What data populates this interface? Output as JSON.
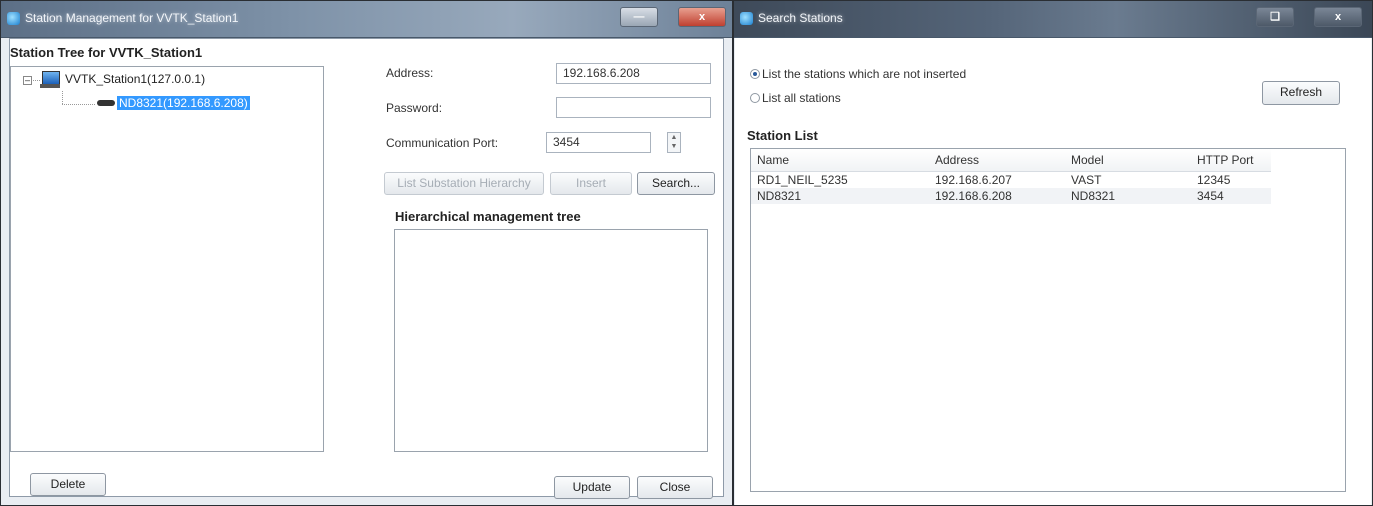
{
  "left_window": {
    "title": "Station Management for VVTK_Station1",
    "station_tree_label": "Station Tree for VVTK_Station1",
    "tree": {
      "root": "VVTK_Station1(127.0.0.1)",
      "child": "ND8321(192.168.6.208)"
    },
    "form": {
      "address_label": "Address:",
      "address_value": "192.168.6.208",
      "password_label": "Password:",
      "password_value": "",
      "port_label": "Communication Port:",
      "port_value": "3454"
    },
    "buttons": {
      "list_substation": "List Substation Hierarchy",
      "insert": "Insert",
      "search": "Search...",
      "delete": "Delete",
      "update": "Update",
      "close": "Close"
    },
    "hierarchical_tree_label": "Hierarchical management tree"
  },
  "right_window": {
    "title": "Search Stations",
    "options": {
      "not_inserted": "List the stations which are not inserted",
      "all": "List all stations"
    },
    "refresh": "Refresh",
    "station_list_label": "Station List",
    "columns": [
      "Name",
      "Address",
      "Model",
      "HTTP Port"
    ],
    "rows": [
      [
        "RD1_NEIL_5235",
        "192.168.6.207",
        "VAST",
        "12345"
      ],
      [
        "ND8321",
        "192.168.6.208",
        "ND8321",
        "3454"
      ]
    ]
  }
}
